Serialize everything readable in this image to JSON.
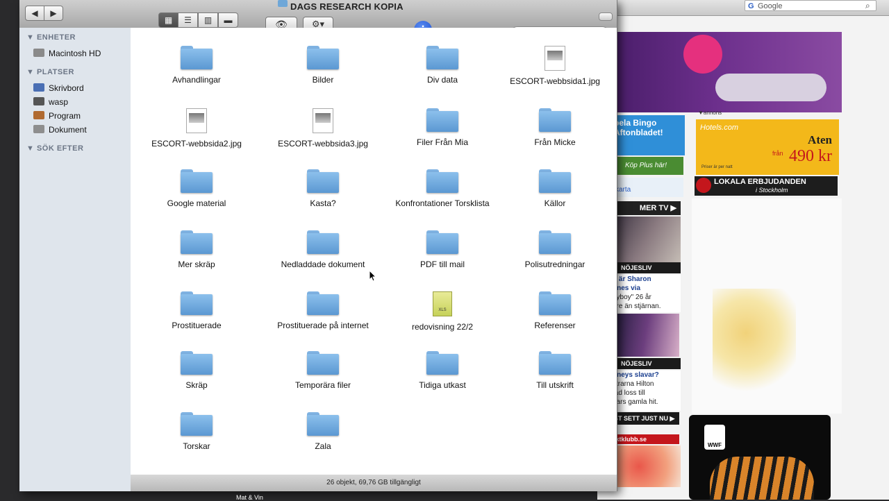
{
  "window": {
    "title": "DAGS RESEARCH KOPIA",
    "status": "26 objekt, 69,76 GB tillgängligt"
  },
  "toolbar": {
    "back_icon": "◀",
    "forward_icon": "▶",
    "view_icon": "▦",
    "view_list": "☰",
    "view_columns": "▥",
    "view_coverflow": "▬",
    "quicklook_icon": "👁",
    "action_icon": "⚙▾",
    "info_icon": "i",
    "search_icon": "🔍",
    "search_value": ""
  },
  "sidebar": {
    "sections": [
      {
        "title": "ENHETER",
        "items": [
          {
            "label": "Macintosh HD",
            "icon": "harddisk-icon",
            "color": "#8a8a8a"
          }
        ]
      },
      {
        "title": "PLATSER",
        "items": [
          {
            "label": "Skrivbord",
            "icon": "desktop-icon",
            "color": "#4a6fb4"
          },
          {
            "label": "wasp",
            "icon": "home-icon",
            "color": "#555555"
          },
          {
            "label": "Program",
            "icon": "applications-icon",
            "color": "#b06a30"
          },
          {
            "label": "Dokument",
            "icon": "documents-icon",
            "color": "#8e8e8e"
          }
        ]
      },
      {
        "title": "SÖK EFTER",
        "items": []
      }
    ]
  },
  "files": [
    {
      "name": "Avhandlingar",
      "kind": "folder"
    },
    {
      "name": "Bilder",
      "kind": "folder"
    },
    {
      "name": "Div data",
      "kind": "folder"
    },
    {
      "name": "ESCORT-webbsida1.jpg",
      "kind": "image"
    },
    {
      "name": "ESCORT-webbsida2.jpg",
      "kind": "image"
    },
    {
      "name": "ESCORT-webbsida3.jpg",
      "kind": "image"
    },
    {
      "name": "Filer Från Mia",
      "kind": "folder"
    },
    {
      "name": "Från Micke",
      "kind": "folder"
    },
    {
      "name": "Google material",
      "kind": "folder"
    },
    {
      "name": "Kasta?",
      "kind": "folder"
    },
    {
      "name": "Konfrontationer Torsklista",
      "kind": "folder"
    },
    {
      "name": "Källor",
      "kind": "folder"
    },
    {
      "name": "Mer skräp",
      "kind": "folder"
    },
    {
      "name": "Nedladdade dokument",
      "kind": "folder"
    },
    {
      "name": "PDF till mail",
      "kind": "folder"
    },
    {
      "name": "Polisutredningar",
      "kind": "folder"
    },
    {
      "name": "Prostituerade",
      "kind": "folder"
    },
    {
      "name": "Prostituerade på internet",
      "kind": "folder"
    },
    {
      "name": "redovisning 22/2",
      "kind": "spreadsheet",
      "badge": "XLS"
    },
    {
      "name": "Referenser",
      "kind": "folder"
    },
    {
      "name": "Skräp",
      "kind": "folder"
    },
    {
      "name": "Temporära filer",
      "kind": "folder"
    },
    {
      "name": "Tidiga utkast",
      "kind": "folder"
    },
    {
      "name": "Till utskrift",
      "kind": "folder"
    },
    {
      "name": "Torskar",
      "kind": "folder"
    },
    {
      "name": "Zala",
      "kind": "folder"
    }
  ],
  "background": {
    "google_label": "Google",
    "annons": "▼annons",
    "hotels_logo": "Hotels.com",
    "hotels_city": "Aten",
    "hotels_from": "från",
    "hotels_price": "490 kr",
    "hotels_small": "Priser är per natt",
    "lokala_1": "LOKALA ERBJUDANDEN",
    "lokala_2": "i Stockholm",
    "bingo": "pela Bingo Aftonbladet!",
    "plus": "Köp Plus här!",
    "karta": "karta",
    "mertv": "MER TV ▶",
    "nojesliv": "NÖJESLIV",
    "news1_a": "n är Sharon",
    "news1_b": "ones via",
    "news1_c": "oyboy\" 26 år",
    "news1_d": "gre än stjärnan.",
    "news2_a": "itneys slavar?",
    "news2_b": "strarna Hilton",
    "news2_c": "tad loss till",
    "news2_d": "ears gamla hit.",
    "sett": "ST SETT JUST NU ▶",
    "klubb": "iktklubb.se",
    "wwf": "WWF",
    "dock": "Mat & Vin"
  }
}
